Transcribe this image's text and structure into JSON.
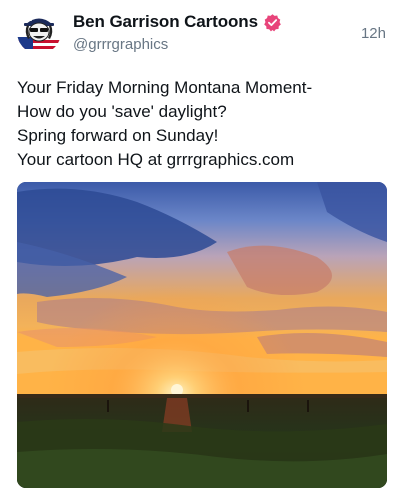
{
  "post": {
    "author": {
      "display_name": "Ben Garrison Cartoons",
      "handle": "@grrrgraphics",
      "verified": true,
      "badge_color": "#e8447a",
      "avatar_icon": "cartoon-avatar-icon"
    },
    "timestamp": "12h",
    "body_lines": [
      "Your Friday Morning Montana Moment-",
      "How do you 'save' daylight?",
      "Spring forward on Sunday!",
      "Your cartoon HQ at grrrgraphics.com"
    ],
    "media": {
      "type": "photo",
      "colors": {
        "sky_top": "#3b5aa8",
        "sky_mid": "#e9a85c",
        "horizon": "#ffb347",
        "sun": "#fff2c0",
        "field": "#1f2a14"
      }
    }
  }
}
